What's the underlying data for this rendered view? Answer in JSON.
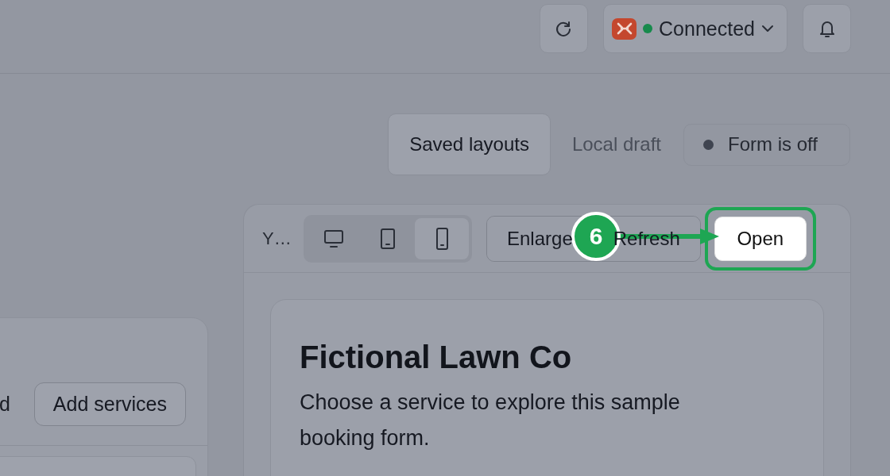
{
  "top_bar": {
    "connection": {
      "label": "Connected",
      "connected": true
    }
  },
  "layout_tabs": [
    {
      "label": "Saved layouts",
      "selected": true
    },
    {
      "label": "Local draft",
      "selected": false
    }
  ],
  "form_status": {
    "label": "Form is off",
    "on": false
  },
  "side_card": {
    "text": "d",
    "button": "Add services"
  },
  "preview": {
    "title": "Y…",
    "device_modes": [
      {
        "kind": "desktop",
        "selected": false
      },
      {
        "kind": "tablet",
        "selected": false
      },
      {
        "kind": "phone",
        "selected": true
      }
    ],
    "actions": [
      {
        "label": "Enlarge",
        "highlighted": false
      },
      {
        "label": "Refresh",
        "highlighted": false
      },
      {
        "label": "Open",
        "highlighted": true
      }
    ],
    "form": {
      "heading": "Fictional Lawn Co",
      "description": "Choose a service to explore this sample booking form."
    }
  },
  "callout": {
    "number": "6"
  }
}
